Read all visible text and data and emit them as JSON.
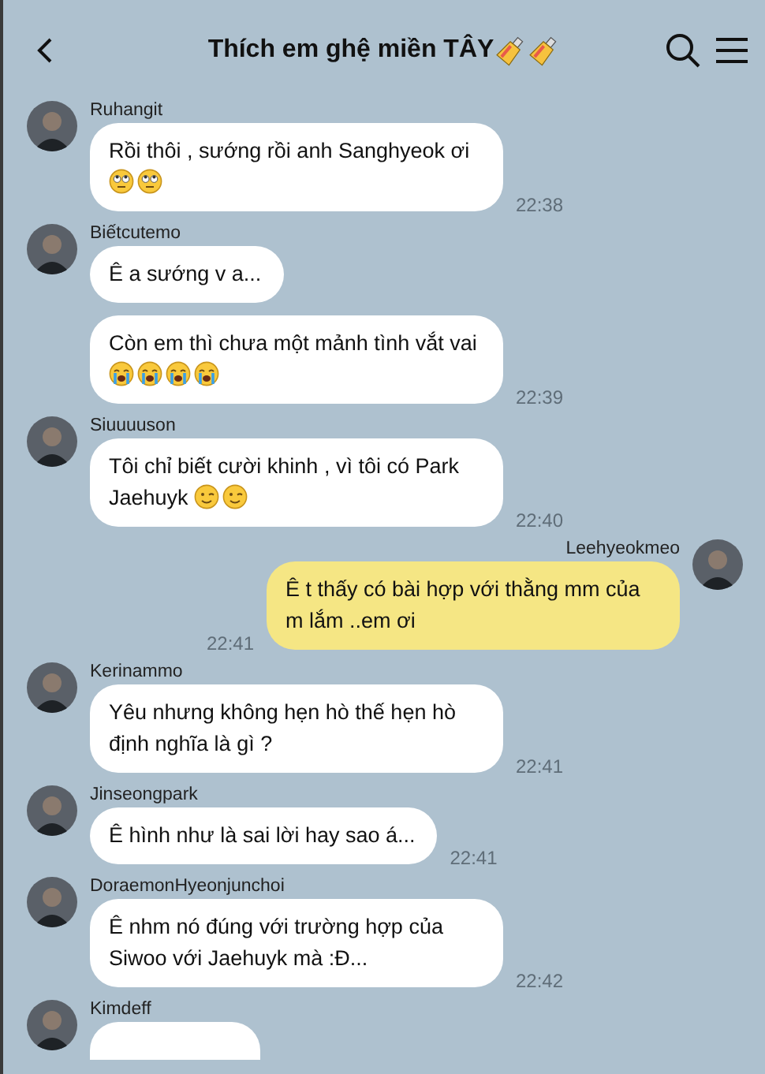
{
  "header": {
    "title": "Thích em ghệ miền TÂY",
    "title_emoji": [
      {
        "kind": "nail-polish"
      },
      {
        "kind": "nail-polish"
      }
    ]
  },
  "groups": [
    {
      "sender": "Ruhangit",
      "own": false,
      "messages": [
        {
          "text": "Rồi thôi , sướng rồi anh Sanghyeok ơi",
          "emoji": [
            {
              "kind": "rolling-eyes"
            },
            {
              "kind": "rolling-eyes"
            }
          ],
          "time": "22:38"
        }
      ]
    },
    {
      "sender": "Biếtcutemo",
      "own": false,
      "messages": [
        {
          "text": "Ê a sướng v a..."
        },
        {
          "text": "Còn em thì chưa một mảnh tình vắt vai",
          "emoji": [
            {
              "kind": "crying"
            },
            {
              "kind": "crying"
            },
            {
              "kind": "crying"
            },
            {
              "kind": "crying"
            }
          ],
          "time": "22:39"
        }
      ]
    },
    {
      "sender": "Siuuuuson",
      "own": false,
      "messages": [
        {
          "text": "Tôi chỉ biết cười khinh , vì tôi có Park Jaehuyk",
          "emoji": [
            {
              "kind": "winking"
            },
            {
              "kind": "winking"
            }
          ],
          "time": "22:40"
        }
      ]
    },
    {
      "sender": "Leehyeokmeo",
      "own": true,
      "messages": [
        {
          "text": "Ê t thấy có bài hợp với thằng mm của m lắm ..em ơi",
          "time": "22:41"
        }
      ]
    },
    {
      "sender": "Kerinammo",
      "own": false,
      "messages": [
        {
          "text": "Yêu nhưng không hẹn hò thế hẹn hò định nghĩa là gì ?",
          "time": "22:41"
        }
      ]
    },
    {
      "sender": "Jinseongpark",
      "own": false,
      "messages": [
        {
          "text": "Ê hình như là sai lời hay sao á...",
          "time": "22:41"
        }
      ]
    },
    {
      "sender": "DoraemonHyeonjunchoi",
      "own": false,
      "messages": [
        {
          "text": "Ê nhm nó đúng với trường hợp của Siwoo với Jaehuyk mà :Đ...",
          "time": "22:42"
        }
      ]
    },
    {
      "sender": "Kimdeff",
      "own": false,
      "messages": [
        {
          "kind": "cut-off"
        }
      ]
    }
  ]
}
